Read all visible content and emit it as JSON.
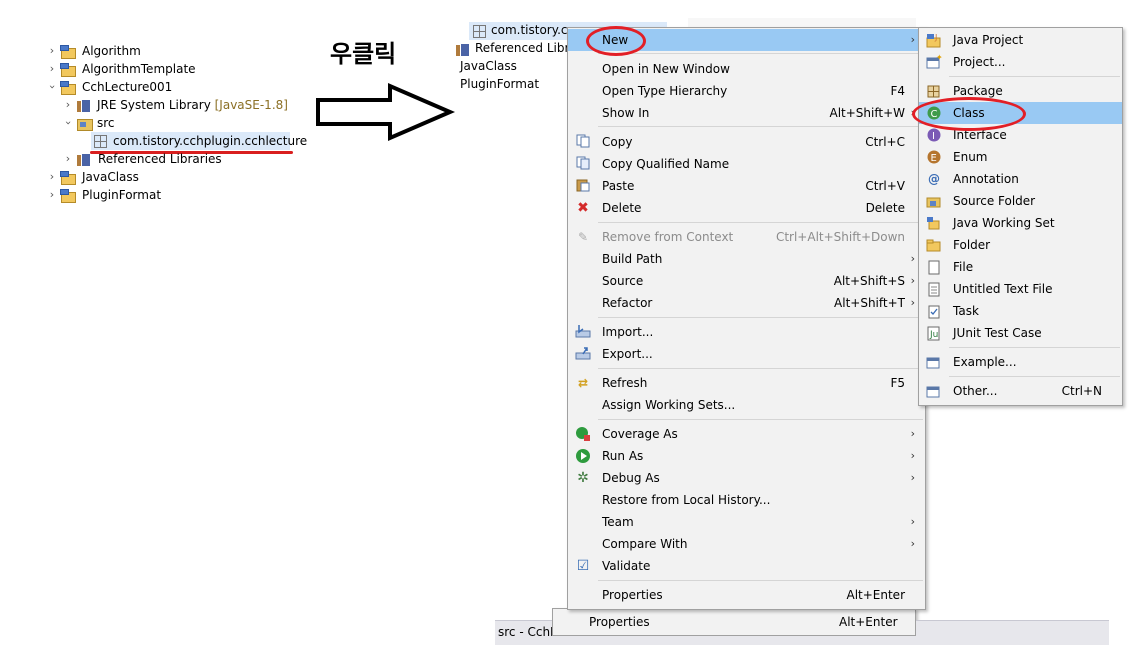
{
  "tree": {
    "items": [
      {
        "label": "Algorithm"
      },
      {
        "label": "AlgorithmTemplate"
      },
      {
        "label": "CchLecture001"
      },
      {
        "label": "JRE System Library",
        "decoration": "[JavaSE-1.8]"
      },
      {
        "label": "src"
      },
      {
        "label": "com.tistory.cchplugin.cchlecture"
      },
      {
        "label": "Referenced Libraries"
      },
      {
        "label": "JavaClass"
      },
      {
        "label": "PluginFormat"
      }
    ]
  },
  "annotation": {
    "korean_label": "우클릭",
    "accent_color": "#e21f26"
  },
  "bg_tree": {
    "selected_label": "com.tistory.cc",
    "items": [
      "Referenced Librar",
      "JavaClass",
      "PluginFormat"
    ]
  },
  "context_menu": {
    "items": [
      {
        "label": "New",
        "arrow": "›"
      },
      {
        "label": "Open in New Window"
      },
      {
        "label": "Open Type Hierarchy",
        "shortcut": "F4"
      },
      {
        "label": "Show In",
        "shortcut": "Alt+Shift+W",
        "arrow": "›"
      },
      {
        "label": "Copy",
        "shortcut": "Ctrl+C",
        "icon": "copy-icon"
      },
      {
        "label": "Copy Qualified Name",
        "icon": "copy-qualified-icon"
      },
      {
        "label": "Paste",
        "shortcut": "Ctrl+V",
        "icon": "paste-icon"
      },
      {
        "label": "Delete",
        "shortcut": "Delete",
        "icon": "delete-icon"
      },
      {
        "label": "Remove from Context",
        "shortcut": "Ctrl+Alt+Shift+Down",
        "icon": "remove-context-icon"
      },
      {
        "label": "Build Path",
        "arrow": "›"
      },
      {
        "label": "Source",
        "shortcut": "Alt+Shift+S",
        "arrow": "›"
      },
      {
        "label": "Refactor",
        "shortcut": "Alt+Shift+T",
        "arrow": "›"
      },
      {
        "label": "Import...",
        "icon": "import-icon"
      },
      {
        "label": "Export...",
        "icon": "export-icon"
      },
      {
        "label": "Refresh",
        "shortcut": "F5",
        "icon": "refresh-icon"
      },
      {
        "label": "Assign Working Sets..."
      },
      {
        "label": "Coverage As",
        "arrow": "›",
        "icon": "coverage-icon"
      },
      {
        "label": "Run As",
        "arrow": "›",
        "icon": "run-icon"
      },
      {
        "label": "Debug As",
        "arrow": "›",
        "icon": "debug-icon"
      },
      {
        "label": "Restore from Local History..."
      },
      {
        "label": "Team",
        "arrow": "›"
      },
      {
        "label": "Compare With",
        "arrow": "›"
      },
      {
        "label": "Validate",
        "icon": "check-icon"
      },
      {
        "label": "Properties",
        "shortcut": "Alt+Enter"
      }
    ]
  },
  "submenu": {
    "items": [
      {
        "label": "Java Project"
      },
      {
        "label": "Project..."
      },
      {
        "label": "Package"
      },
      {
        "label": "Class"
      },
      {
        "label": "Interface"
      },
      {
        "label": "Enum"
      },
      {
        "label": "Annotation"
      },
      {
        "label": "Source Folder"
      },
      {
        "label": "Java Working Set"
      },
      {
        "label": "Folder"
      },
      {
        "label": "File"
      },
      {
        "label": "Untitled Text File"
      },
      {
        "label": "Task"
      },
      {
        "label": "JUnit Test Case"
      },
      {
        "label": "Example..."
      },
      {
        "label": "Other...",
        "shortcut": "Ctrl+N"
      }
    ]
  },
  "behind_menu": {
    "label": "Properties",
    "shortcut": "Alt+Enter"
  },
  "status_bar": {
    "text": "src - CchL"
  }
}
